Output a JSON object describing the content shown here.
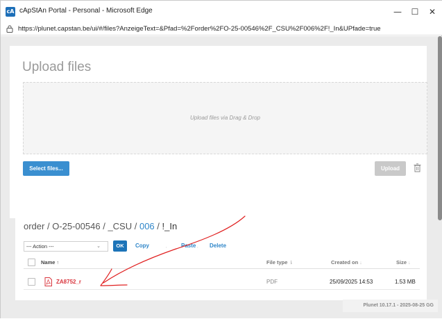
{
  "window": {
    "title": "cApStAn Portal - Personal - Microsoft Edge",
    "url": "https://plunet.capstan.be/ui/#/files?AnzeigeText=&Pfad=%2Forder%2FO-25-00546%2F_CSU%2F006%2F!_In&UPfade=true",
    "minimize_glyph": "—",
    "maximize_glyph": "☐",
    "close_glyph": "✕"
  },
  "upload": {
    "title": "Upload files",
    "dropzone_text": "Upload files via Drag & Drop",
    "select_button": "Select files...",
    "upload_button": "Upload"
  },
  "files": {
    "breadcrumb": {
      "order": "order",
      "sep1": " / ",
      "order_no": "O-25-00546",
      "sep2": " / ",
      "csu": "_CSU",
      "sep3": " / ",
      "folder": "006",
      "sep4": " / ",
      "current": "!_In"
    },
    "action_select": "--- Action ---",
    "ok_button": "OK",
    "copy_link": "Copy",
    "paste_link": "Paste",
    "delete_link": "Delete",
    "separator": ",",
    "columns": {
      "name": "Name",
      "name_sort": "↑",
      "type": "File type",
      "type_sort": "⇂",
      "created": "Created on",
      "created_sort": "↓",
      "size": "Size",
      "size_sort": "↓"
    },
    "rows": [
      {
        "name": "ZA8752_r",
        "type": "PDF",
        "created": "25/09/2025 14:53",
        "size": "1.53 MB"
      }
    ]
  },
  "footer": {
    "version": "Plunet 10.17.1 - 2025-08-25 GG"
  },
  "colors": {
    "accent": "#3a8fd0",
    "link": "#2f86c9",
    "file_name": "#d9363e",
    "annotation": "#e02020"
  },
  "icons": {
    "app": "capstan-app-icon",
    "lock": "lock-icon",
    "trash": "trash-icon",
    "pdf": "pdf-file-icon",
    "chevron": "chevron-down-icon"
  }
}
